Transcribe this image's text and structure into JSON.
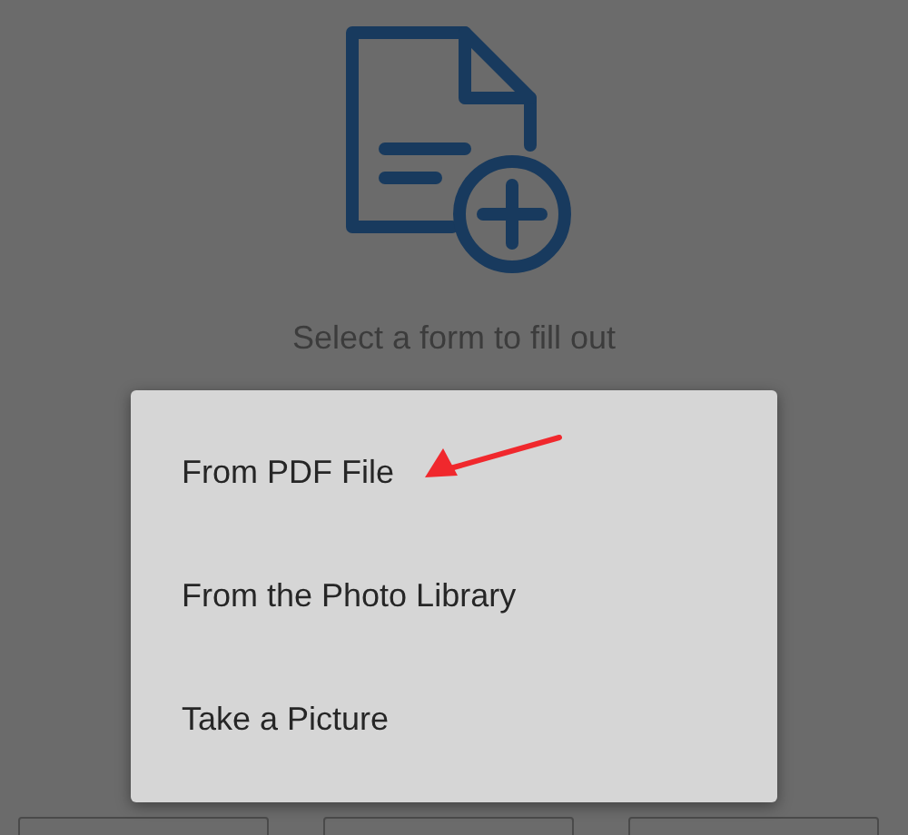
{
  "prompt": "Select a form to fill out",
  "menu": {
    "items": [
      {
        "label": "From PDF File",
        "highlighted": true
      },
      {
        "label": "From the Photo Library",
        "highlighted": false
      },
      {
        "label": "Take a Picture",
        "highlighted": false
      }
    ]
  },
  "tiles": [
    {
      "kind": "tile"
    },
    {
      "kind": "tile"
    },
    {
      "kind": "tile"
    }
  ]
}
